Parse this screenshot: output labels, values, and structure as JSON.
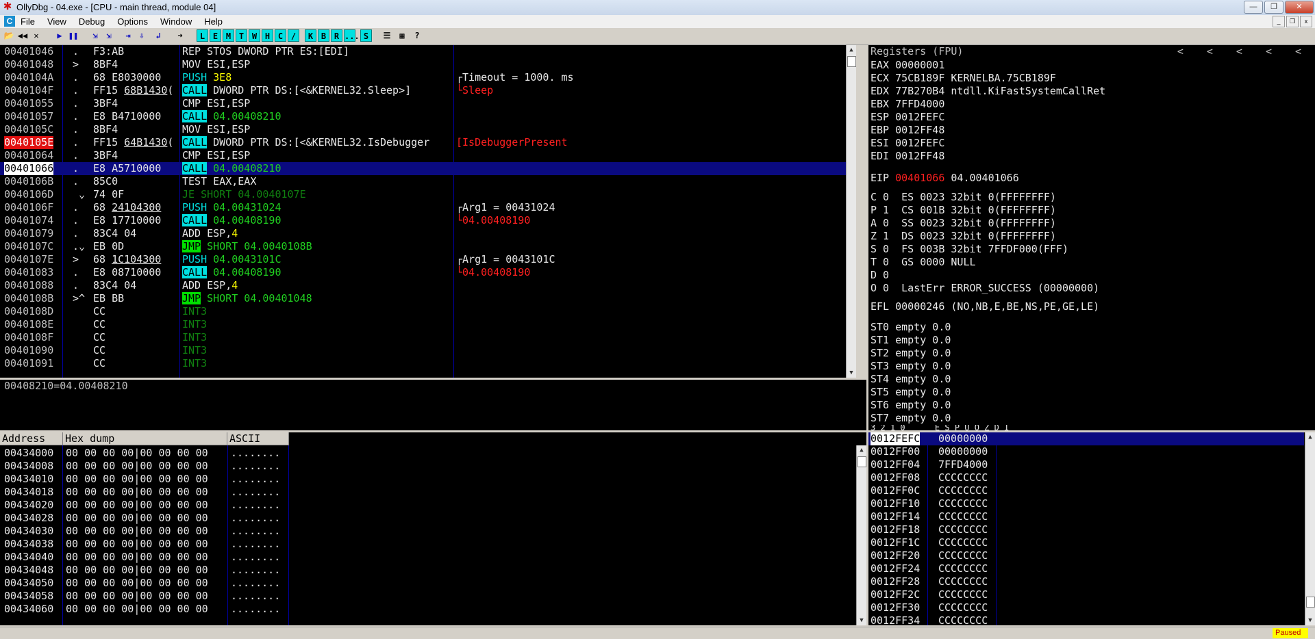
{
  "window": {
    "title": "OllyDbg - 04.exe - [CPU - main thread, module 04]",
    "buttons": [
      "—",
      "❐",
      "✕"
    ]
  },
  "menu": {
    "icon": "C",
    "items": [
      "File",
      "View",
      "Debug",
      "Options",
      "Window",
      "Help"
    ],
    "mdi_buttons": [
      "_",
      "❐",
      "x"
    ]
  },
  "toolbar": {
    "gray": [
      "📂",
      "◀◀",
      "✕",
      "▶",
      "❚❚",
      "⇲",
      "⇲",
      "⇥",
      "⇩",
      "↲",
      "➜"
    ],
    "cyan": [
      "L",
      "E",
      "M",
      "T",
      "W",
      "H",
      "C",
      "/",
      "K",
      "B",
      "R",
      "...",
      "S"
    ],
    "right": [
      "☰",
      "▦",
      "?"
    ]
  },
  "disasm": [
    {
      "addr": "00401046",
      "mark": ".",
      "hex": "F3:AB",
      "hexul": "",
      "hexrest": "",
      "mn": "REP STOS DWORD PTR ES:[EDI]",
      "style": "plain",
      "cmt": "",
      "cmtc": ""
    },
    {
      "addr": "00401048",
      "mark": ">",
      "hex": "8BF4",
      "hexul": "",
      "hexrest": "",
      "mn": "MOV ESI,ESP",
      "style": "plain",
      "cmt": "",
      "cmtc": ""
    },
    {
      "addr": "0040104A",
      "mark": ".",
      "hex": "68 E8030000",
      "hexul": "",
      "hexrest": "",
      "mn": "PUSH",
      "arg": "3E8",
      "style": "push-y",
      "cmt": "┌Timeout = 1000. ms",
      "cmtc": "white"
    },
    {
      "addr": "0040104F",
      "mark": ".",
      "hex": "FF15 ",
      "hexul": "68B1430",
      "hexrest": "(",
      "mn": "CALL",
      "arg": " DWORD PTR DS:[<&KERNEL32.Sleep>]",
      "style": "call-w",
      "cmt": "└Sleep",
      "cmtc": "red"
    },
    {
      "addr": "00401055",
      "mark": ".",
      "hex": "3BF4",
      "hexul": "",
      "hexrest": "",
      "mn": "CMP ESI,ESP",
      "style": "plain",
      "cmt": "",
      "cmtc": ""
    },
    {
      "addr": "00401057",
      "mark": ".",
      "hex": "E8 B4710000",
      "hexul": "",
      "hexrest": "",
      "mn": "CALL",
      "arg": " 04.00408210",
      "style": "call-g",
      "cmt": "",
      "cmtc": ""
    },
    {
      "addr": "0040105C",
      "mark": ".",
      "hex": "8BF4",
      "hexul": "",
      "hexrest": "",
      "mn": "MOV ESI,ESP",
      "style": "plain",
      "cmt": "",
      "cmtc": ""
    },
    {
      "addr": "0040105E",
      "mark": ".",
      "hex": "FF15 ",
      "hexul": "64B1430",
      "hexrest": "(",
      "mn": "CALL",
      "arg": " DWORD PTR DS:[<&KERNEL32.IsDebugger",
      "style": "call-w",
      "cmt": "[IsDebuggerPresent",
      "cmtc": "red",
      "bp": true
    },
    {
      "addr": "00401064",
      "mark": ".",
      "hex": "3BF4",
      "hexul": "",
      "hexrest": "",
      "mn": "CMP ESI,ESP",
      "style": "plain",
      "cmt": "",
      "cmtc": ""
    },
    {
      "addr": "00401066",
      "mark": ".",
      "hex": "E8 A5710000",
      "hexul": "",
      "hexrest": "",
      "mn": "CALL",
      "arg": " 04.00408210",
      "style": "call-g",
      "cmt": "",
      "cmtc": "",
      "sel": true
    },
    {
      "addr": "0040106B",
      "mark": ".",
      "hex": "85C0",
      "hexul": "",
      "hexrest": "",
      "mn": "TEST EAX,EAX",
      "style": "plain",
      "cmt": "",
      "cmtc": ""
    },
    {
      "addr": "0040106D",
      "mark": " ⌄",
      "hex": "74 0F",
      "hexul": "",
      "hexrest": "",
      "mn": "JE SHORT 04.0040107E",
      "style": "dgreen",
      "cmt": "",
      "cmtc": ""
    },
    {
      "addr": "0040106F",
      "mark": ".",
      "hex": "68 ",
      "hexul": "24104300",
      "hexrest": "",
      "mn": "PUSH",
      "arg": " 04.00431024",
      "style": "push-g",
      "cmt": "┌Arg1 = 00431024",
      "cmtc": "white"
    },
    {
      "addr": "00401074",
      "mark": ".",
      "hex": "E8 17710000",
      "hexul": "",
      "hexrest": "",
      "mn": "CALL",
      "arg": " 04.00408190",
      "style": "call-g",
      "cmt": "└04.00408190",
      "cmtc": "red"
    },
    {
      "addr": "00401079",
      "mark": ".",
      "hex": "83C4 04",
      "hexul": "",
      "hexrest": "",
      "mn": "ADD ESP,",
      "arg": "4",
      "style": "add-y",
      "cmt": "",
      "cmtc": ""
    },
    {
      "addr": "0040107C",
      "mark": ".⌄",
      "hex": "EB 0D",
      "hexul": "",
      "hexrest": "",
      "mn": "JMP",
      "arg": " SHORT 04.0040108B",
      "style": "jmp",
      "cmt": "",
      "cmtc": ""
    },
    {
      "addr": "0040107E",
      "mark": ">",
      "hex": "68 ",
      "hexul": "1C104300",
      "hexrest": "",
      "mn": "PUSH",
      "arg": " 04.0043101C",
      "style": "push-g",
      "cmt": "┌Arg1 = 0043101C",
      "cmtc": "white"
    },
    {
      "addr": "00401083",
      "mark": ".",
      "hex": "E8 08710000",
      "hexul": "",
      "hexrest": "",
      "mn": "CALL",
      "arg": " 04.00408190",
      "style": "call-g",
      "cmt": "└04.00408190",
      "cmtc": "red"
    },
    {
      "addr": "00401088",
      "mark": ".",
      "hex": "83C4 04",
      "hexul": "",
      "hexrest": "",
      "mn": "ADD ESP,",
      "arg": "4",
      "style": "add-y",
      "cmt": "",
      "cmtc": ""
    },
    {
      "addr": "0040108B",
      "mark": ">^",
      "hex": "EB BB",
      "hexul": "",
      "hexrest": "",
      "mn": "JMP",
      "arg": " SHORT 04.00401048",
      "style": "jmp",
      "cmt": "",
      "cmtc": ""
    },
    {
      "addr": "0040108D",
      "mark": "",
      "hex": "CC",
      "hexul": "",
      "hexrest": "",
      "mn": "INT3",
      "style": "dgreen",
      "cmt": "",
      "cmtc": ""
    },
    {
      "addr": "0040108E",
      "mark": "",
      "hex": "CC",
      "hexul": "",
      "hexrest": "",
      "mn": "INT3",
      "style": "dgreen",
      "cmt": "",
      "cmtc": ""
    },
    {
      "addr": "0040108F",
      "mark": "",
      "hex": "CC",
      "hexul": "",
      "hexrest": "",
      "mn": "INT3",
      "style": "dgreen",
      "cmt": "",
      "cmtc": ""
    },
    {
      "addr": "00401090",
      "mark": "",
      "hex": "CC",
      "hexul": "",
      "hexrest": "",
      "mn": "INT3",
      "style": "dgreen",
      "cmt": "",
      "cmtc": ""
    },
    {
      "addr": "00401091",
      "mark": "",
      "hex": "CC",
      "hexul": "",
      "hexrest": "",
      "mn": "INT3",
      "style": "dgreen",
      "cmt": "",
      "cmtc": ""
    }
  ],
  "info_line": "00408210=04.00408210",
  "registers": {
    "title": "Registers (FPU)",
    "arrows": [
      "<",
      "<",
      "<",
      "<",
      "<"
    ],
    "gp": [
      {
        "t": "EAX 00000001"
      },
      {
        "t": "ECX 75CB189F KERNELBA.75CB189F"
      },
      {
        "t": "EDX 77B270B4 ntdll.KiFastSystemCallRet"
      },
      {
        "t": "EBX 7FFD4000"
      },
      {
        "t": "ESP 0012FEFC"
      },
      {
        "t": "EBP 0012FF48"
      },
      {
        "t": "ESI 0012FEFC"
      },
      {
        "t": "EDI 0012FF48"
      }
    ],
    "eip_label": "EIP",
    "eip_value": "00401066",
    "eip_desc": "04.00401066",
    "flags": [
      "C 0  ES 0023 32bit 0(FFFFFFFF)",
      "P 1  CS 001B 32bit 0(FFFFFFFF)",
      "A 0  SS 0023 32bit 0(FFFFFFFF)",
      "Z 1  DS 0023 32bit 0(FFFFFFFF)",
      "S 0  FS 003B 32bit 7FFDF000(FFF)",
      "T 0  GS 0000 NULL",
      "D 0",
      "O 0  LastErr ERROR_SUCCESS (00000000)"
    ],
    "efl": "EFL 00000246 (NO,NB,E,BE,NS,PE,GE,LE)",
    "fpu": [
      "ST0 empty 0.0",
      "ST1 empty 0.0",
      "ST2 empty 0.0",
      "ST3 empty 0.0",
      "ST4 empty 0.0",
      "ST5 empty 0.0",
      "ST6 empty 0.0",
      "ST7 empty 0.0"
    ],
    "fpu_tail": "3 2 1 0      E S P U O Z D I"
  },
  "dump": {
    "headers": [
      "Address",
      "Hex dump",
      "ASCII"
    ],
    "rows": [
      {
        "addr": "00434000",
        "hex": "00 00 00 00|00 00 00 00",
        "ascii": "........"
      },
      {
        "addr": "00434008",
        "hex": "00 00 00 00|00 00 00 00",
        "ascii": "........"
      },
      {
        "addr": "00434010",
        "hex": "00 00 00 00|00 00 00 00",
        "ascii": "........"
      },
      {
        "addr": "00434018",
        "hex": "00 00 00 00|00 00 00 00",
        "ascii": "........"
      },
      {
        "addr": "00434020",
        "hex": "00 00 00 00|00 00 00 00",
        "ascii": "........"
      },
      {
        "addr": "00434028",
        "hex": "00 00 00 00|00 00 00 00",
        "ascii": "........"
      },
      {
        "addr": "00434030",
        "hex": "00 00 00 00|00 00 00 00",
        "ascii": "........"
      },
      {
        "addr": "00434038",
        "hex": "00 00 00 00|00 00 00 00",
        "ascii": "........"
      },
      {
        "addr": "00434040",
        "hex": "00 00 00 00|00 00 00 00",
        "ascii": "........"
      },
      {
        "addr": "00434048",
        "hex": "00 00 00 00|00 00 00 00",
        "ascii": "........"
      },
      {
        "addr": "00434050",
        "hex": "00 00 00 00|00 00 00 00",
        "ascii": "........"
      },
      {
        "addr": "00434058",
        "hex": "00 00 00 00|00 00 00 00",
        "ascii": "........"
      },
      {
        "addr": "00434060",
        "hex": "00 00 00 00|00 00 00 00",
        "ascii": "........"
      }
    ]
  },
  "stack": [
    {
      "addr": "0012FEFC",
      "val": "00000000",
      "sel": true
    },
    {
      "addr": "0012FF00",
      "val": "00000000"
    },
    {
      "addr": "0012FF04",
      "val": "7FFD4000"
    },
    {
      "addr": "0012FF08",
      "val": "CCCCCCCC"
    },
    {
      "addr": "0012FF0C",
      "val": "CCCCCCCC"
    },
    {
      "addr": "0012FF10",
      "val": "CCCCCCCC"
    },
    {
      "addr": "0012FF14",
      "val": "CCCCCCCC"
    },
    {
      "addr": "0012FF18",
      "val": "CCCCCCCC"
    },
    {
      "addr": "0012FF1C",
      "val": "CCCCCCCC"
    },
    {
      "addr": "0012FF20",
      "val": "CCCCCCCC"
    },
    {
      "addr": "0012FF24",
      "val": "CCCCCCCC"
    },
    {
      "addr": "0012FF28",
      "val": "CCCCCCCC"
    },
    {
      "addr": "0012FF2C",
      "val": "CCCCCCCC"
    },
    {
      "addr": "0012FF30",
      "val": "CCCCCCCC"
    },
    {
      "addr": "0012FF34",
      "val": "CCCCCCCC"
    }
  ],
  "status": {
    "state": "Paused"
  }
}
